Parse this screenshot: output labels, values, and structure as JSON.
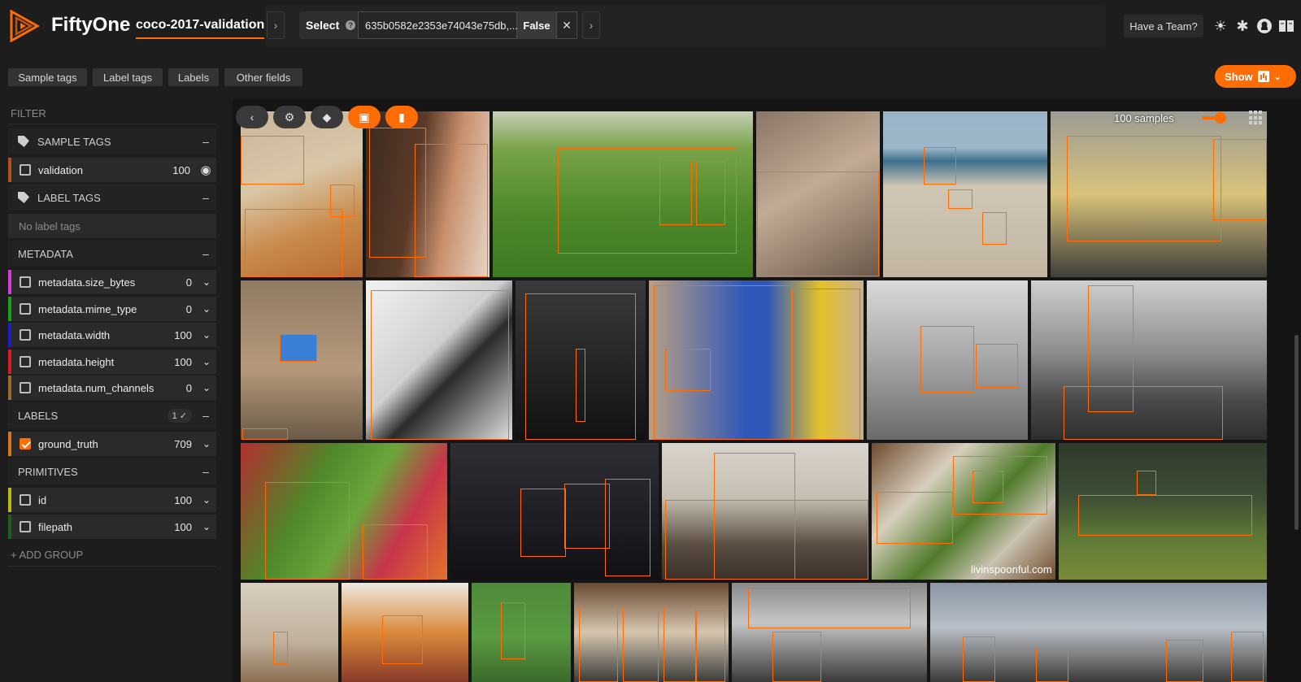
{
  "header": {
    "app_name": "FiftyOne",
    "dataset": "coco-2017-validation",
    "view_bar": {
      "stage_name": "Select",
      "stage_value": "635b0582e2353e74043e75db,...",
      "stage_bool": "False"
    },
    "team_button": "Have a Team?"
  },
  "toolbar": {
    "tabs": [
      "Sample tags",
      "Label tags",
      "Labels",
      "Other fields"
    ],
    "show_label": "Show"
  },
  "sidebar": {
    "filter_title": "FILTER",
    "groups": {
      "sample_tags": "SAMPLE TAGS",
      "label_tags": "LABEL TAGS",
      "metadata": "METADATA",
      "labels": "LABELS",
      "primitives": "PRIMITIVES"
    },
    "validation": {
      "label": "validation",
      "count": "100"
    },
    "no_label_tags": "No label tags",
    "metadata_fields": [
      {
        "label": "metadata.size_bytes",
        "count": "0",
        "color": "#d63bd6"
      },
      {
        "label": "metadata.mime_type",
        "count": "0",
        "color": "#19a319"
      },
      {
        "label": "metadata.width",
        "count": "100",
        "color": "#1e1ec4"
      },
      {
        "label": "metadata.height",
        "count": "100",
        "color": "#d61e1e"
      },
      {
        "label": "metadata.num_channels",
        "count": "0",
        "color": "#a06a2e"
      }
    ],
    "labels_badge": "1 ✓",
    "ground_truth": {
      "label": "ground_truth",
      "count": "709",
      "color": "#d6781e"
    },
    "primitive_fields": [
      {
        "label": "id",
        "count": "100",
        "color": "#b8b81e"
      },
      {
        "label": "filepath",
        "count": "100",
        "color": "#1e5e1e"
      }
    ],
    "add_group": "+ ADD GROUP"
  },
  "grid": {
    "samples_label": "100 samples",
    "watermark": "livinspoonful.com"
  },
  "colors": {
    "accent": "#ff6d04",
    "background": "#151515",
    "panel": "#1d1d1d"
  }
}
